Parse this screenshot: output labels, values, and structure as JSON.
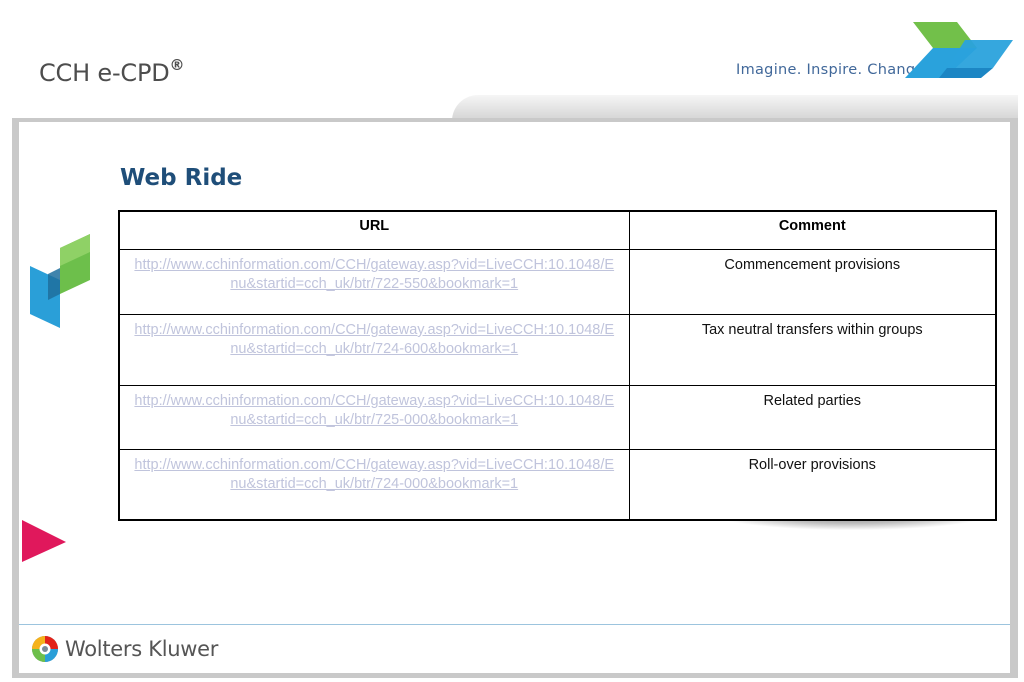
{
  "header": {
    "product_name": "CCH e-CPD",
    "product_mark": "®",
    "tagline": "Imagine. Inspire. Change."
  },
  "slide": {
    "title": "Web Ride",
    "table": {
      "columns": [
        "URL",
        "Comment"
      ],
      "rows": [
        {
          "url": "http://www.cchinformation.com/CCH/gateway.asp?vid=LiveCCH:10.1048/Enu&startid=cch_uk/btr/722-550&bookmark=1",
          "comment": "Commencement provisions"
        },
        {
          "url": "http://www.cchinformation.com/CCH/gateway.asp?vid=LiveCCH:10.1048/Enu&startid=cch_uk/btr/724-600&bookmark=1",
          "comment": "Tax neutral transfers within groups"
        },
        {
          "url": "http://www.cchinformation.com/CCH/gateway.asp?vid=LiveCCH:10.1048/Enu&startid=cch_uk/btr/725-000&bookmark=1",
          "comment": "Related parties"
        },
        {
          "url": "http://www.cchinformation.com/CCH/gateway.asp?vid=LiveCCH:10.1048/Enu&startid=cch_uk/btr/724-000&bookmark=1",
          "comment": "Roll-over provisions"
        }
      ]
    }
  },
  "footer": {
    "brand": "Wolters Kluwer"
  },
  "colors": {
    "title": "#1f4e79",
    "link": "#c0c4dc",
    "tagline": "#41689a",
    "brand_green": "#6dbf4b",
    "brand_blue": "#2a9fd8",
    "accent_pink": "#e0185c",
    "footer_rule": "#9cc4de"
  },
  "icons": [
    "brand-chevron-icon",
    "brand-cube-icon",
    "accent-arrow-icon",
    "globe-logo-icon"
  ]
}
